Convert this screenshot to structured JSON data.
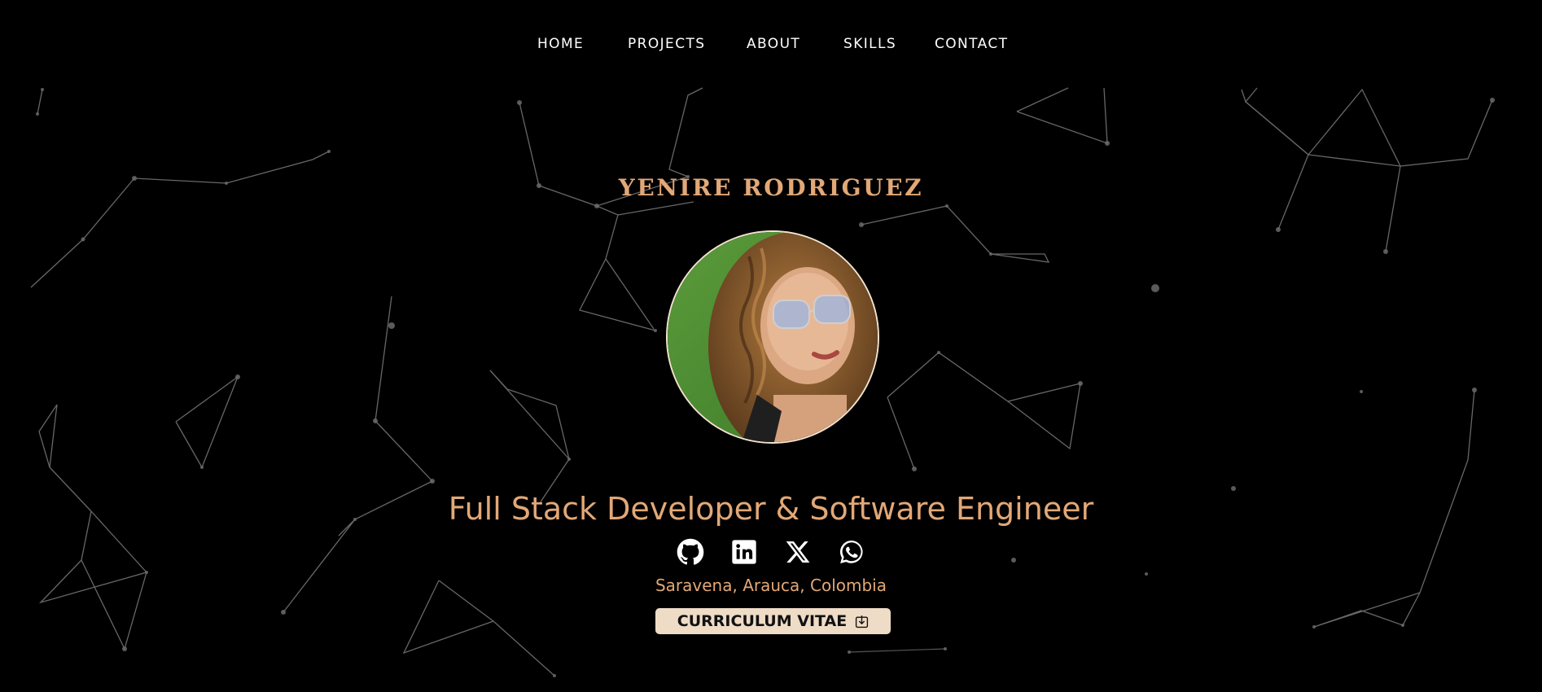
{
  "nav": {
    "items": [
      {
        "label": "HOME"
      },
      {
        "label": "PROJECTS"
      },
      {
        "label": "ABOUT"
      },
      {
        "label": "SKILLS"
      },
      {
        "label": "CONTACT"
      }
    ]
  },
  "hero": {
    "name": "YENIRE RODRIGUEZ",
    "role": "Full Stack Developer & Software Engineer",
    "location": "Saravena, Arauca, Colombia",
    "cv_button": {
      "label": "CURRICULUM VITAE",
      "icon": "download-icon"
    },
    "social": [
      {
        "icon": "github-icon"
      },
      {
        "icon": "linkedin-icon"
      },
      {
        "icon": "x-twitter-icon"
      },
      {
        "icon": "whatsapp-icon"
      }
    ]
  },
  "colors": {
    "background": "#000000",
    "accent": "#e2a877",
    "button_bg": "#efdcc6",
    "nav_text": "#ffffff"
  }
}
